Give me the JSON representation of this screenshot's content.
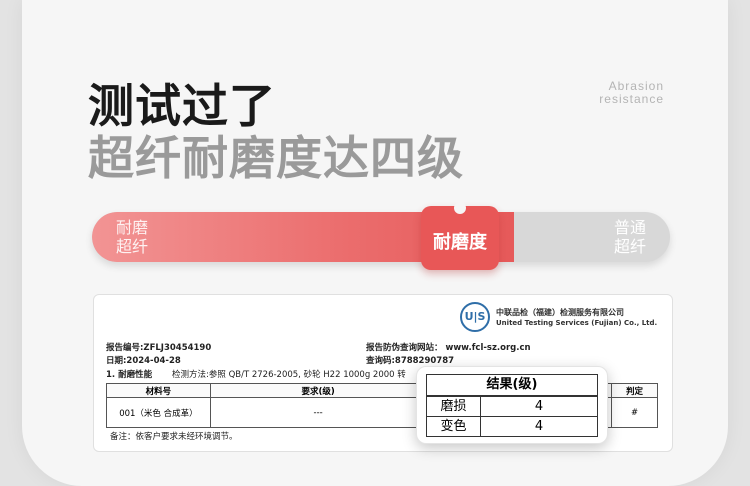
{
  "headline": {
    "line1": "测试过了",
    "line2": "超纤耐磨度达四级",
    "english": [
      "Abrasion",
      "resistance"
    ]
  },
  "bar": {
    "left_label": [
      "耐磨",
      "超纤"
    ],
    "right_label": [
      "普通",
      "超纤"
    ],
    "badge": "耐磨度",
    "fill_fraction": 0.73,
    "colors": {
      "fill": "#e85757",
      "track": "#d8d8d8"
    }
  },
  "report": {
    "org_cn": "中联品检（福建）检测服务有限公司",
    "org_en": "United Testing Services (Fujian) Co., Ltd.",
    "logo_text": "U|S",
    "report_no": "报告编号:ZFLJ30454190",
    "date": "日期:2024-04-28",
    "verify_site": "报告防伪查询网站：   www.fcl-sz.org.cn",
    "verify_code": "查询码:8788290787",
    "section": "1.   耐磨性能",
    "method": "检测方法:参照 QB/T 2726-2005, 砂轮 H22 1000g 2000 转",
    "table": {
      "headers": [
        "材料号",
        "要求(级)",
        "",
        "判定"
      ],
      "row": [
        "001（米色 合成革）",
        "---",
        "",
        "#"
      ]
    },
    "note": "备注：依客户要求未经环境调节。"
  },
  "magnifier": {
    "header": "结果(级)",
    "rows": [
      {
        "label": "磨损",
        "value": "4"
      },
      {
        "label": "变色",
        "value": "4"
      }
    ]
  }
}
